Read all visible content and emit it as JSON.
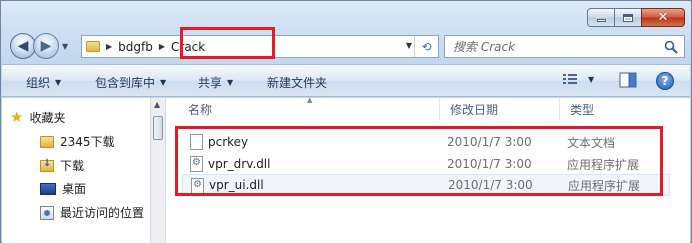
{
  "window": {
    "caption_buttons": {
      "minimize": "minimize-icon",
      "maximize": "maximize-icon",
      "close": "close-icon"
    }
  },
  "nav": {
    "back_glyph": "◀",
    "forward_glyph": "▶",
    "dropdown_glyph": "▼"
  },
  "address": {
    "crumbs": [
      "bdgfb",
      "Crack"
    ],
    "separator_glyph": "▶",
    "dropdown_glyph": "▼",
    "refresh_glyph": "⟲"
  },
  "search": {
    "placeholder": "搜索 Crack"
  },
  "toolbar": {
    "organize": "组织",
    "include_in_library": "包含到库中",
    "share": "共享",
    "new_folder": "新建文件夹",
    "dropdown_glyph": "▼",
    "help_glyph": "?"
  },
  "sidebar": {
    "favorites": "收藏夹",
    "items": [
      {
        "label": "2345下载",
        "icon": "folder-icon"
      },
      {
        "label": "下载",
        "icon": "download-folder-icon"
      },
      {
        "label": "桌面",
        "icon": "desktop-icon"
      },
      {
        "label": "最近访问的位置",
        "icon": "recent-places-icon"
      }
    ]
  },
  "columns": {
    "name": "名称",
    "date": "修改日期",
    "type": "类型"
  },
  "files": [
    {
      "name": "pcrkey",
      "date": "2010/1/7 3:00",
      "type": "文本文档",
      "icon": "text-file-icon"
    },
    {
      "name": "vpr_drv.dll",
      "date": "2010/1/7 3:00",
      "type": "应用程序扩展",
      "icon": "dll-file-icon"
    },
    {
      "name": "vpr_ui.dll",
      "date": "2010/1/7 3:00",
      "type": "应用程序扩展",
      "icon": "dll-file-icon"
    }
  ],
  "colors": {
    "highlight_box": "#e01d26"
  }
}
